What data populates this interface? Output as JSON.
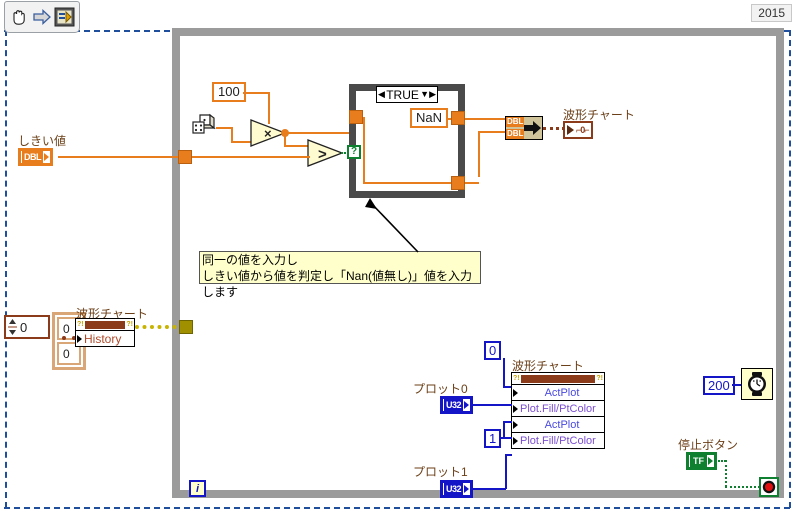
{
  "window": {
    "version_tag": "2015",
    "toolbar": [
      {
        "name": "hand-tool",
        "glyph": "✋"
      },
      {
        "name": "run-arrow",
        "glyph": "➡"
      },
      {
        "name": "vi-icon",
        "glyph": "▣"
      }
    ]
  },
  "constants": {
    "multiplier": "100",
    "nan": "NaN",
    "wait_ms": "200",
    "act_plot_0": "0",
    "act_plot_1": "1",
    "array_index": "0",
    "array_elements": [
      "0",
      "0"
    ]
  },
  "case_structure": {
    "selector_value": "TRUE",
    "left_arrow": "◀",
    "right_arrow": "▶",
    "dropdown_arrow": "▼",
    "selector_input": "?"
  },
  "terminals": {
    "threshold": {
      "label": "しきい値",
      "type_tag": "DBL"
    },
    "chart_out": {
      "label": "波形チャート",
      "glyph": "⌐0⌐"
    },
    "chart_history": {
      "label": "波形チャート",
      "property": "History"
    },
    "chart_props": {
      "label": "波形チャート"
    },
    "plot0": {
      "label": "プロット0",
      "type_tag": "U32"
    },
    "plot1": {
      "label": "プロット1",
      "type_tag": "U32"
    },
    "stop_button": {
      "label": "停止ボタン",
      "type_tag": "TF"
    }
  },
  "property_node": {
    "rows": [
      {
        "name": "ActPlot",
        "centered": true
      },
      {
        "name": "Plot.Fill/PtColor",
        "centered": false
      },
      {
        "name": "ActPlot",
        "centered": true
      },
      {
        "name": "Plot.Fill/PtColor",
        "centered": false
      }
    ]
  },
  "bundle": {
    "in_tags": [
      "DBL",
      "DBL"
    ]
  },
  "nodes": {
    "multiply": "×",
    "greater_than": ">",
    "random_number": "random-number-dice",
    "wait_timer": "wait-ms-clock",
    "iteration": "i"
  },
  "annotation": {
    "line1": "同一の値を入力し",
    "line2": "しきい値から値を判定し「Nan(値無し)」値を入力します"
  },
  "colors": {
    "wire_double": "#e87d1e",
    "wire_u32": "#1515c8",
    "wire_boolean": "#0f8030",
    "wire_error": "#c8b400",
    "loop_border": "#9b9b9b",
    "page_border": "#1f4e9c",
    "annotation_bg": "#ffffcc"
  }
}
